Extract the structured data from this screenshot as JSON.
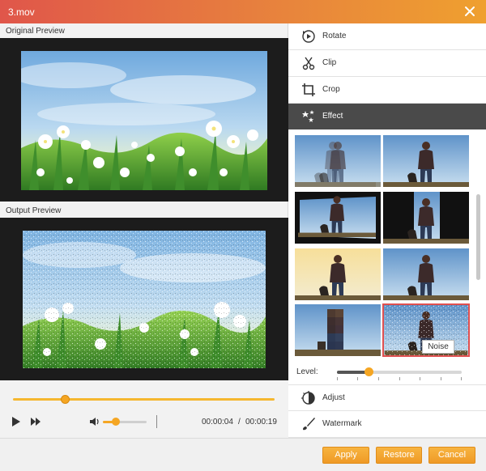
{
  "window": {
    "title": "3.mov"
  },
  "left": {
    "original_label": "Original Preview",
    "output_label": "Output Preview"
  },
  "player": {
    "progress": 0.2,
    "volume": 0.3,
    "current_time": "00:00:04",
    "time_separator": "/",
    "total_time": "00:00:19"
  },
  "menu": {
    "items": [
      {
        "label": "Rotate",
        "icon": "rotate-icon"
      },
      {
        "label": "Clip",
        "icon": "scissors-icon"
      },
      {
        "label": "Crop",
        "icon": "crop-icon"
      },
      {
        "label": "Effect",
        "icon": "stars-icon",
        "active": true
      },
      {
        "label": "Adjust",
        "icon": "adjust-icon"
      },
      {
        "label": "Watermark",
        "icon": "brush-icon"
      }
    ]
  },
  "effects": {
    "selected_tooltip": "Noise",
    "level_label": "Level:",
    "level": 0.25
  },
  "footer": {
    "apply": "Apply",
    "restore": "Restore",
    "cancel": "Cancel"
  },
  "colors": {
    "accent": "#f5a623",
    "title_gradient_start": "#e0564a",
    "title_gradient_end": "#efa02f",
    "active_menu": "#4a4a4a",
    "selected_border": "#e05050"
  }
}
